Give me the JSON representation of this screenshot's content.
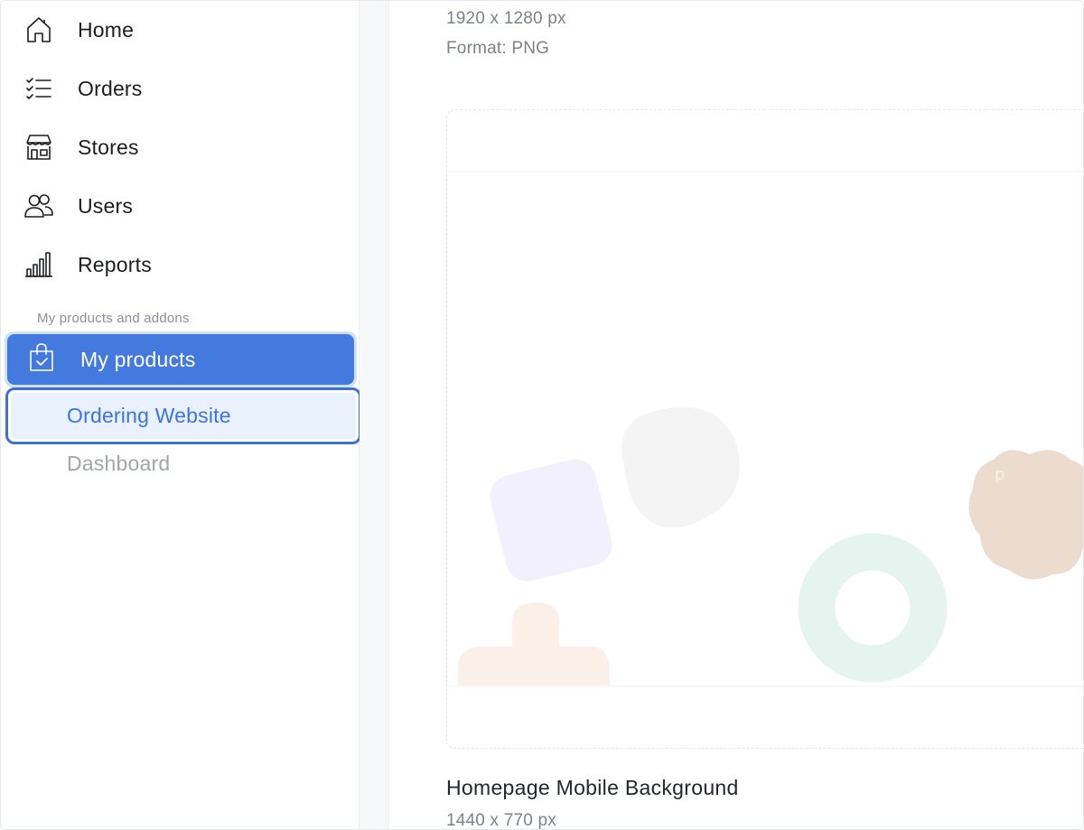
{
  "sidebar": {
    "items": [
      {
        "label": "Home",
        "icon": "home-icon"
      },
      {
        "label": "Orders",
        "icon": "list-check-icon"
      },
      {
        "label": "Stores",
        "icon": "store-icon"
      },
      {
        "label": "Users",
        "icon": "users-icon"
      },
      {
        "label": "Reports",
        "icon": "bar-chart-icon"
      }
    ],
    "section_label": "My products and addons",
    "my_products": {
      "label": "My products",
      "icon": "shopping-bag-check-icon"
    },
    "sub_items": [
      {
        "label": "Ordering Website",
        "active": true
      },
      {
        "label": "Dashboard",
        "active": false
      }
    ]
  },
  "main": {
    "top_image": {
      "dimensions": "1920 x 1280 px",
      "format": "Format: PNG"
    },
    "preview_image": {
      "title": "Homepage Mobile Background",
      "dimensions": "1440 x 770 px"
    }
  },
  "colors": {
    "accent": "#4479de",
    "accent_border": "#3e6fda",
    "active_bg": "#e9f1fd",
    "shape_lavender": "#f3f0fd",
    "shape_gray": "#f4f4f4",
    "shape_mint": "#e5f4ee",
    "shape_peach": "#faf0e8",
    "shape_tan": "#ecdcd0"
  }
}
